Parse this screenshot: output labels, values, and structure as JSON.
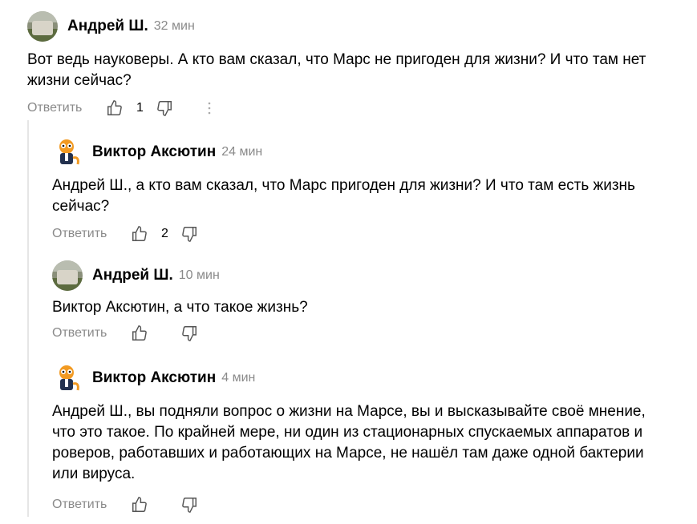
{
  "comments": [
    {
      "author": "Андрей Ш.",
      "time": "32 мин",
      "text": "Вот ведь науковеры. А кто вам сказал, что Марс не пригоден для жизни? И что там нет жизни сейчас?",
      "reply_label": "Ответить",
      "likes": "1",
      "avatar": "photo-avatar"
    },
    {
      "author": "Виктор Аксютин",
      "time": "24 мин",
      "text": "Андрей Ш., а кто вам сказал, что Марс пригоден для жизни? И что там есть жизнь сейчас?",
      "reply_label": "Ответить",
      "likes": "2",
      "avatar": "cartoon-cat-avatar"
    },
    {
      "author": "Андрей Ш.",
      "time": "10 мин",
      "text": "Виктор Аксютин, а что такое жизнь?",
      "reply_label": "Ответить",
      "likes": "",
      "avatar": "photo-avatar"
    },
    {
      "author": "Виктор Аксютин",
      "time": "4 мин",
      "text": "Андрей Ш., вы подняли вопрос о жизни на Марсе, вы и высказывайте своё мнение, что это такое. По крайней мере, ни один из стационарных спускаемых аппаратов и роверов, работавших и работающих на Марсе, не нашёл там даже одной бактерии или вируса.",
      "reply_label": "Ответить",
      "likes": "",
      "avatar": "cartoon-cat-avatar"
    }
  ],
  "icons": {
    "like": "thumbs-up-icon",
    "dislike": "thumbs-down-icon",
    "more": "more-vertical-icon"
  }
}
